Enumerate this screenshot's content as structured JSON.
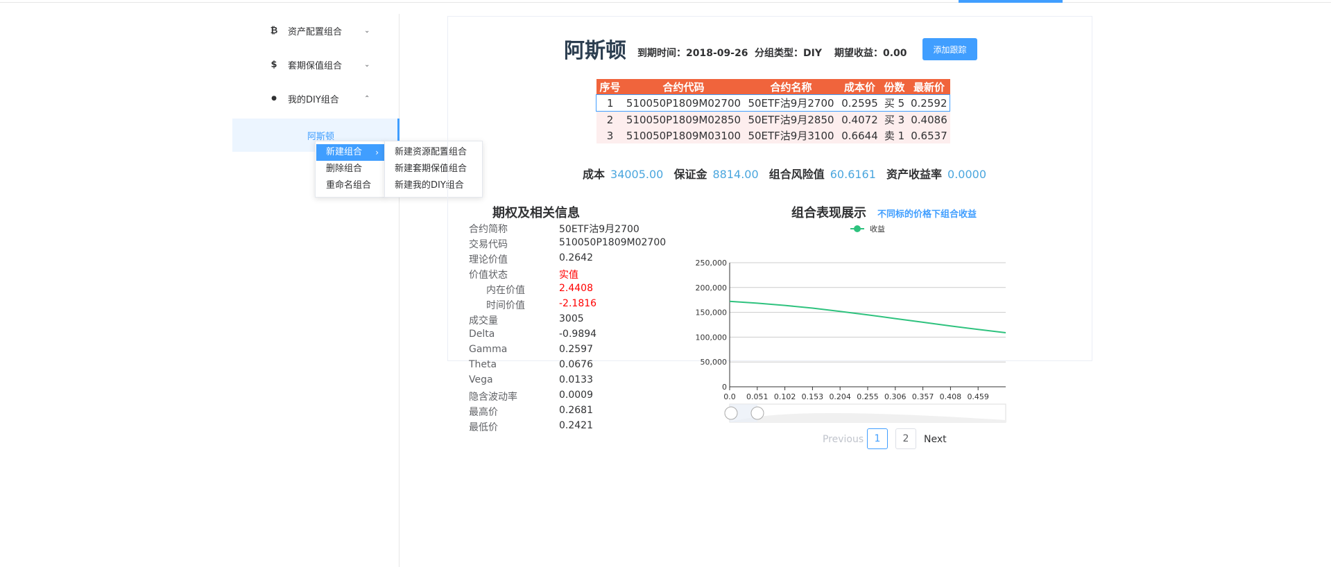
{
  "sidebar": {
    "items": [
      {
        "icon": "bitcoin-icon",
        "glyph": "₿",
        "label": "资产配置组合",
        "arrow": "⌄"
      },
      {
        "icon": "dollar-icon",
        "glyph": "$",
        "label": "套期保值组合",
        "arrow": "⌄"
      },
      {
        "icon": "location-pin-icon",
        "glyph": "●",
        "label": "我的DIY组合",
        "arrow": "⌃"
      }
    ],
    "sub_item": "阿斯顿"
  },
  "context_menu": {
    "items": [
      "新建组合",
      "删除组合",
      "重命名组合"
    ],
    "arrow": "›",
    "submenu": [
      "新建资源配置组合",
      "新建套期保值组合",
      "新建我的DIY组合"
    ]
  },
  "header": {
    "name": "阿斯顿",
    "expiry_label": "到期时间：",
    "expiry": "2018-09-26",
    "type_label": "分组类型：",
    "type": "DIY",
    "expect_label": "期望收益：",
    "expect": "0.00",
    "add_button": "添加跟踪"
  },
  "table": {
    "headers": [
      "序号",
      "合约代码",
      "合约名称",
      "成本价",
      "份数",
      "最新价"
    ],
    "rows": [
      [
        "1",
        "510050P1809M02700",
        "50ETF沽9月2700",
        "0.2595",
        "买 5",
        "0.2592"
      ],
      [
        "2",
        "510050P1809M02850",
        "50ETF沽9月2850",
        "0.4072",
        "买 3",
        "0.4086"
      ],
      [
        "3",
        "510050P1809M03100",
        "50ETF沽9月3100",
        "0.6644",
        "卖 1",
        "0.6537"
      ]
    ]
  },
  "summary": {
    "cost_label": "成本",
    "cost": "34005.00",
    "margin_label": "保证金",
    "margin": "8814.00",
    "risk_label": "组合风险值",
    "risk": "60.6161",
    "roi_label": "资产收益率",
    "roi": "0.0000"
  },
  "info": {
    "title": "期权及相关信息",
    "rows": [
      {
        "label": "合约简称",
        "value": "50ETF沽9月2700"
      },
      {
        "label": "交易代码",
        "value": "510050P1809M02700"
      },
      {
        "label": "理论价值",
        "value": "0.2642"
      },
      {
        "label": "价值状态",
        "value": "实值"
      },
      {
        "label": "内在价值",
        "value": "2.4408"
      },
      {
        "label": "时间价值",
        "value": "-2.1816"
      },
      {
        "label": "成交量",
        "value": "3005"
      },
      {
        "label": "Delta",
        "value": "-0.9894"
      },
      {
        "label": "Gamma",
        "value": "0.2597"
      },
      {
        "label": "Theta",
        "value": "0.0676"
      },
      {
        "label": "Vega",
        "value": "0.0133"
      },
      {
        "label": "隐含波动率",
        "value": "0.0009"
      },
      {
        "label": "最高价",
        "value": "0.2681"
      },
      {
        "label": "最低价",
        "value": "0.2421"
      }
    ]
  },
  "chart_title": "组合表现展示",
  "chart_subtitle": "不同标的价格下组合收益",
  "chart_data": {
    "type": "line",
    "title": "",
    "xlabel": "",
    "ylabel": "",
    "x_ticks": [
      "0.0",
      "0.051",
      "0.102",
      "0.153",
      "0.204",
      "0.255",
      "0.306",
      "0.357",
      "0.408",
      "0.459"
    ],
    "y_ticks": [
      "0",
      "50,000",
      "100,000",
      "150,000",
      "200,000",
      "250,000"
    ],
    "xlim": [
      0,
      0.51
    ],
    "ylim": [
      0,
      250000
    ],
    "grid": true,
    "legend": "top",
    "series": [
      {
        "name": "收益",
        "color": "#2ec27e",
        "x": [
          0,
          0.051,
          0.102,
          0.153,
          0.204,
          0.255,
          0.306,
          0.357,
          0.408,
          0.459,
          0.51
        ],
        "y": [
          172000,
          168500,
          164000,
          158500,
          152000,
          145000,
          137500,
          130000,
          122500,
          115500,
          109000
        ]
      }
    ]
  },
  "pagination": {
    "prev": "Previous",
    "pages": [
      "1",
      "2"
    ],
    "next": "Next"
  },
  "colors": {
    "accent": "#409eff",
    "table_header": "#f0643c",
    "value_blue": "#4aa6de",
    "alert": "#ff0000"
  }
}
